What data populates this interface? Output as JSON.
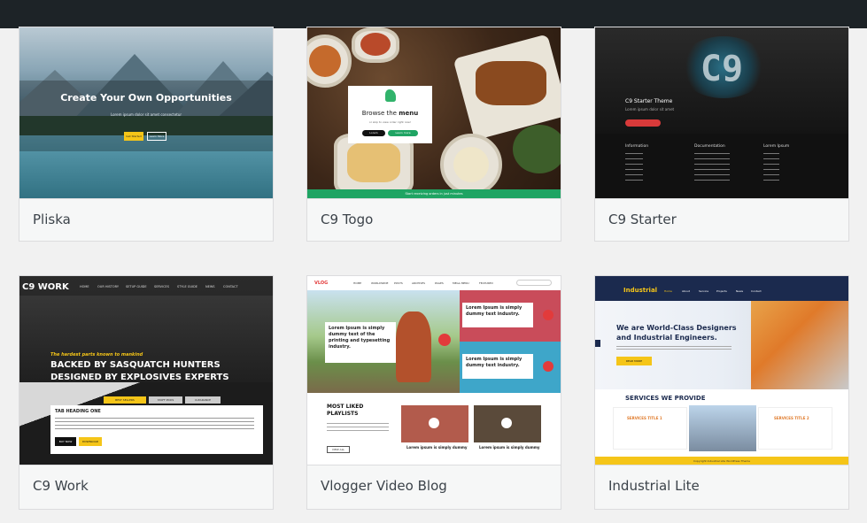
{
  "themes": [
    {
      "name": "Pliska",
      "preview": {
        "headline": "Create Your Own Opportunities",
        "subline": "Lorem ipsum dolor sit amet consectetur",
        "button_primary": "Get Started",
        "button_secondary": "Learn More"
      }
    },
    {
      "name": "C9 Togo",
      "preview": {
        "modal_title_a": "Browse the",
        "modal_title_b": "menu",
        "modal_sub": "or skip to view order right now!",
        "button_a": "Lorem",
        "button_b": "Learn more",
        "footer": "Start receiving orders in just minutes"
      }
    },
    {
      "name": "C9 Starter",
      "preview": {
        "logo": "C9",
        "title": "C9 Starter Theme",
        "sub": "Lorem ipsum dolor sit amet",
        "cols": [
          "Information",
          "Documentation",
          "Lorem Ipsum"
        ]
      }
    },
    {
      "name": "C9 Work",
      "preview": {
        "logo": "C9 WORK",
        "nav": [
          "HOME",
          "OUR HISTORY",
          "SETUP GUIDE",
          "SERVICES",
          "STYLE GUIDE",
          "NEWS",
          "CONTACT"
        ],
        "tagline": "The hardest parts known to mankind",
        "headline_1": "BACKED BY SASQUATCH HUNTERS",
        "headline_2": "DESIGNED BY EXPLOSIVES EXPERTS",
        "tabs": [
          "BEST SELLERS",
          "STAFF PICKS",
          "CLEARANCE"
        ],
        "tab_heading": "TAB HEADING ONE",
        "btn_a": "BUY NOW",
        "btn_b": "DOWNLOAD"
      }
    },
    {
      "name": "Vlogger Video Blog",
      "preview": {
        "logo": "VLOG",
        "nav": [
          "HOME",
          "WORLDWIDE",
          "POSTS",
          "ARCHIVES",
          "PAGES",
          "MEGA MENU",
          "FEATURED"
        ],
        "hero_text": "Lorem Ipsum is simply dummy text of the printing and typesetting industry.",
        "card_text": "Lorem Ipsum is simply dummy text industry.",
        "section_title": "MOST LIKED PLAYLISTS",
        "caption": "Lorem ipsum is simply dummy",
        "view_all": "VIEW ALL"
      }
    },
    {
      "name": "Industrial Lite",
      "preview": {
        "logo": "Industrial",
        "nav": [
          "Home",
          "About",
          "Service",
          "Projects",
          "News",
          "Contact"
        ],
        "headline_1": "We are World-Class Designers",
        "headline_2": "and Industrial Engineers.",
        "button": "READ MORE",
        "section": "SERVICES WE PROVIDE",
        "service_1": "SERVICES TITLE 1",
        "service_2": "SERVICES TITLE 2",
        "footer": "Copyright Industrial Lite WordPress Theme"
      }
    }
  ],
  "colors": {
    "topbar": "#1d2327",
    "card_footer": "#f6f7f7",
    "accent_yellow": "#f5c518",
    "togo_green": "#1fa463",
    "c9_red": "#d83a3a"
  }
}
